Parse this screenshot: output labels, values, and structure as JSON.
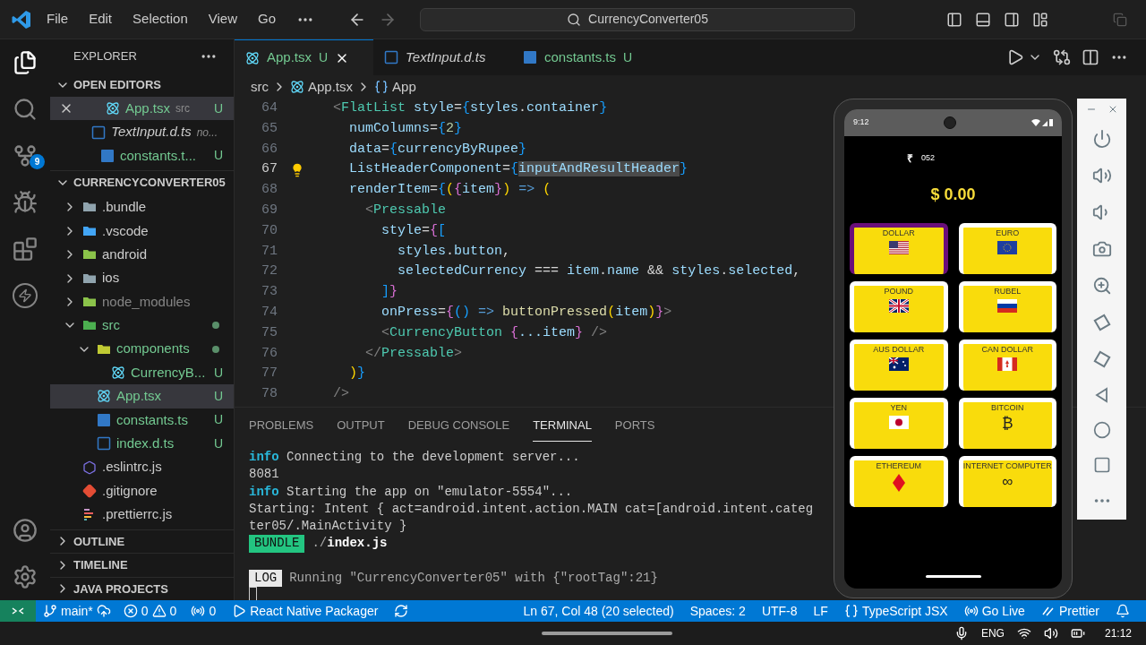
{
  "menu": [
    "File",
    "Edit",
    "Selection",
    "View",
    "Go"
  ],
  "command_center": "CurrencyConverter05",
  "activity": {
    "source_control_badge": "9"
  },
  "explorer": {
    "title": "EXPLORER",
    "open_editors": {
      "title": "OPEN EDITORS",
      "expanded": true,
      "items": [
        {
          "name": "App.tsx",
          "kind": "react",
          "detail": "src",
          "badge": "U",
          "untracked": true,
          "preview": false,
          "selected": true
        },
        {
          "name": "TextInput.d.ts",
          "kind": "tsdecl",
          "detail": "no...",
          "untracked": false,
          "preview": true,
          "selected": false
        },
        {
          "name": "constants.t...",
          "kind": "ts",
          "badge": "U",
          "untracked": true,
          "preview": false,
          "selected": false
        }
      ]
    },
    "project": {
      "title": "CURRENCYCONVERTER05",
      "expanded": true,
      "items": [
        {
          "name": ".bundle",
          "kind": "folder",
          "expanded": false,
          "untracked": false,
          "ignored": false,
          "selected": false
        },
        {
          "name": ".vscode",
          "kind": "vscode",
          "expanded": false,
          "untracked": false,
          "ignored": false,
          "selected": false
        },
        {
          "name": "android",
          "kind": "android",
          "expanded": false,
          "untracked": false,
          "ignored": false,
          "selected": false
        },
        {
          "name": "ios",
          "kind": "ios",
          "expanded": false,
          "untracked": false,
          "ignored": false,
          "selected": false
        },
        {
          "name": "node_modules",
          "kind": "node",
          "expanded": false,
          "untracked": false,
          "ignored": true,
          "selected": false
        },
        {
          "name": "src",
          "kind": "src",
          "expanded": true,
          "untracked": true,
          "ignored": false,
          "dot": true,
          "selected": false,
          "children": [
            {
              "name": "components",
              "kind": "components",
              "expanded": true,
              "untracked": true,
              "ignored": false,
              "dot": true,
              "selected": false,
              "children": [
                {
                  "name": "CurrencyB...",
                  "kind": "react",
                  "badge": "U",
                  "untracked": true,
                  "ignored": false,
                  "selected": false
                }
              ]
            },
            {
              "name": "App.tsx",
              "kind": "react",
              "badge": "U",
              "untracked": true,
              "ignored": false,
              "selected": true
            },
            {
              "name": "constants.ts",
              "kind": "ts",
              "badge": "U",
              "untracked": true,
              "ignored": false,
              "selected": false
            },
            {
              "name": "index.d.ts",
              "kind": "tsdecl",
              "badge": "U",
              "untracked": true,
              "ignored": false,
              "selected": false
            }
          ]
        },
        {
          "name": ".eslintrc.js",
          "kind": "eslint",
          "untracked": false,
          "ignored": false,
          "selected": false
        },
        {
          "name": ".gitignore",
          "kind": "git",
          "untracked": false,
          "ignored": false,
          "selected": false
        },
        {
          "name": ".prettierrc.js",
          "kind": "prettier",
          "untracked": false,
          "ignored": false,
          "selected": false
        }
      ]
    },
    "sections": [
      {
        "title": "OUTLINE",
        "expanded": false
      },
      {
        "title": "TIMELINE",
        "expanded": false
      },
      {
        "title": "JAVA PROJECTS",
        "expanded": false
      }
    ]
  },
  "tabs": [
    {
      "label": "App.tsx",
      "kind": "react",
      "badge": "U",
      "untracked": true,
      "preview": false,
      "selected": true
    },
    {
      "label": "TextInput.d.ts",
      "kind": "tsdecl",
      "untracked": false,
      "preview": true,
      "selected": false
    },
    {
      "label": "constants.ts",
      "kind": "ts",
      "badge": "U",
      "untracked": true,
      "preview": false,
      "selected": false
    }
  ],
  "breadcrumb": [
    "src",
    "App.tsx",
    "App"
  ],
  "lines": [
    {
      "number": "64",
      "current": false,
      "tokens": [
        {
          "kind": "p",
          "text": "  <"
        },
        {
          "kind": "tag",
          "text": "FlatList"
        },
        {
          "kind": "attr",
          "text": " style"
        },
        {
          "kind": "op",
          "text": "="
        },
        {
          "kind": "b3",
          "text": "{"
        },
        {
          "kind": "attr",
          "text": "styles"
        },
        {
          "kind": "op",
          "text": "."
        },
        {
          "kind": "attr",
          "text": "container"
        },
        {
          "kind": "b3",
          "text": "}"
        }
      ]
    },
    {
      "number": "65",
      "current": false,
      "tokens": [
        {
          "kind": "attr",
          "text": "    numColumns"
        },
        {
          "kind": "op",
          "text": "="
        },
        {
          "kind": "b3",
          "text": "{"
        },
        {
          "kind": "num",
          "text": "2"
        },
        {
          "kind": "b3",
          "text": "}"
        }
      ]
    },
    {
      "number": "66",
      "current": false,
      "tokens": [
        {
          "kind": "attr",
          "text": "    data"
        },
        {
          "kind": "op",
          "text": "="
        },
        {
          "kind": "b3",
          "text": "{"
        },
        {
          "kind": "attr",
          "text": "currencyByRupee"
        },
        {
          "kind": "b3",
          "text": "}"
        }
      ]
    },
    {
      "number": "67",
      "current": true,
      "tokens": [
        {
          "kind": "attr",
          "text": "    ListHeaderComponent"
        },
        {
          "kind": "op",
          "text": "="
        },
        {
          "kind": "b3",
          "text": "{"
        },
        {
          "kind": "sel",
          "text": "inputAndResultHeader"
        },
        {
          "kind": "b3",
          "text": "}"
        }
      ]
    },
    {
      "number": "68",
      "current": false,
      "tokens": [
        {
          "kind": "attr",
          "text": "    renderItem"
        },
        {
          "kind": "op",
          "text": "="
        },
        {
          "kind": "b3",
          "text": "{"
        },
        {
          "kind": "b1",
          "text": "("
        },
        {
          "kind": "b2",
          "text": "{"
        },
        {
          "kind": "attr",
          "text": "item"
        },
        {
          "kind": "b2",
          "text": "}"
        },
        {
          "kind": "b1",
          "text": ")"
        },
        {
          "kind": "kw",
          "text": " =>"
        },
        {
          "kind": "b1",
          "text": " ("
        }
      ]
    },
    {
      "number": "69",
      "current": false,
      "tokens": [
        {
          "kind": "p",
          "text": "      <"
        },
        {
          "kind": "tag",
          "text": "Pressable"
        }
      ]
    },
    {
      "number": "70",
      "current": false,
      "tokens": [
        {
          "kind": "attr",
          "text": "        style"
        },
        {
          "kind": "op",
          "text": "="
        },
        {
          "kind": "b2",
          "text": "{"
        },
        {
          "kind": "b3",
          "text": "["
        }
      ]
    },
    {
      "number": "71",
      "current": false,
      "tokens": [
        {
          "kind": "attr",
          "text": "          styles"
        },
        {
          "kind": "op",
          "text": "."
        },
        {
          "kind": "attr",
          "text": "button"
        },
        {
          "kind": "op",
          "text": ","
        }
      ]
    },
    {
      "number": "72",
      "current": false,
      "tokens": [
        {
          "kind": "attr",
          "text": "          selectedCurrency"
        },
        {
          "kind": "op",
          "text": " === "
        },
        {
          "kind": "attr",
          "text": "item"
        },
        {
          "kind": "op",
          "text": "."
        },
        {
          "kind": "attr",
          "text": "name"
        },
        {
          "kind": "op",
          "text": " && "
        },
        {
          "kind": "attr",
          "text": "styles"
        },
        {
          "kind": "op",
          "text": "."
        },
        {
          "kind": "attr",
          "text": "selected"
        },
        {
          "kind": "op",
          "text": ","
        }
      ]
    },
    {
      "number": "73",
      "current": false,
      "tokens": [
        {
          "kind": "b3",
          "text": "        ]"
        },
        {
          "kind": "b2",
          "text": "}"
        }
      ]
    },
    {
      "number": "74",
      "current": false,
      "tokens": [
        {
          "kind": "attr",
          "text": "        onPress"
        },
        {
          "kind": "op",
          "text": "="
        },
        {
          "kind": "b2",
          "text": "{"
        },
        {
          "kind": "b3",
          "text": "()"
        },
        {
          "kind": "kw",
          "text": " =>"
        },
        {
          "kind": "fn",
          "text": " buttonPressed"
        },
        {
          "kind": "b1",
          "text": "("
        },
        {
          "kind": "attr",
          "text": "item"
        },
        {
          "kind": "b1",
          "text": ")"
        },
        {
          "kind": "b2",
          "text": "}"
        },
        {
          "kind": "p",
          "text": ">"
        }
      ]
    },
    {
      "number": "75",
      "current": false,
      "tokens": [
        {
          "kind": "p",
          "text": "        <"
        },
        {
          "kind": "tag",
          "text": "CurrencyButton"
        },
        {
          "kind": "b2",
          "text": " {"
        },
        {
          "kind": "attr",
          "text": "...item"
        },
        {
          "kind": "b2",
          "text": "}"
        },
        {
          "kind": "p",
          "text": " />"
        }
      ]
    },
    {
      "number": "76",
      "current": false,
      "tokens": [
        {
          "kind": "p",
          "text": "      </"
        },
        {
          "kind": "tag",
          "text": "Pressable"
        },
        {
          "kind": "p",
          "text": ">"
        }
      ]
    },
    {
      "number": "77",
      "current": false,
      "tokens": [
        {
          "kind": "b1",
          "text": "    )"
        },
        {
          "kind": "b3",
          "text": "}"
        }
      ]
    },
    {
      "number": "78",
      "current": false,
      "tokens": [
        {
          "kind": "p",
          "text": "  />"
        }
      ]
    }
  ],
  "panel_tabs": [
    {
      "label": "PROBLEMS",
      "selected": false
    },
    {
      "label": "OUTPUT",
      "selected": false
    },
    {
      "label": "DEBUG CONSOLE",
      "selected": false
    },
    {
      "label": "TERMINAL",
      "selected": true
    },
    {
      "label": "PORTS",
      "selected": false
    }
  ],
  "terminal": [
    {
      "kind": "info",
      "tag": "info",
      "text": "Connecting to the development server..."
    },
    {
      "kind": "plain",
      "text": "8081"
    },
    {
      "kind": "info",
      "tag": "info",
      "text": "Starting the app on \"emulator-5554\"..."
    },
    {
      "kind": "plain",
      "text": "Starting: Intent { act=android.intent.action.MAIN cat=[android.intent.categ"
    },
    {
      "kind": "plain",
      "text": "ter05/.MainActivity }"
    },
    {
      "kind": "badge",
      "tag": "BUNDLE",
      "color": "#23c581",
      "text": "./**index.js**"
    },
    {
      "kind": "blank"
    },
    {
      "kind": "badge",
      "tag": "LOG",
      "color": "#e8e8e8",
      "text": "Running \"CurrencyConverter05\" with {\"rootTag\":21}"
    },
    {
      "kind": "cursor"
    }
  ],
  "status_bar": {
    "branch": "main*",
    "errors": "0",
    "warnings": "0",
    "ports": "0",
    "packager": "React Native Packager",
    "right": [
      {
        "kind": "plain",
        "text": "Ln 67, Col 48 (20 selected)"
      },
      {
        "kind": "plain",
        "text": "Spaces: 2"
      },
      {
        "kind": "plain",
        "text": "UTF-8"
      },
      {
        "kind": "plain",
        "text": "LF"
      },
      {
        "kind": "braces",
        "text": "TypeScript JSX"
      },
      {
        "kind": "golive",
        "text": "Go Live"
      },
      {
        "kind": "prettier",
        "text": "Prettier"
      },
      {
        "kind": "bell"
      }
    ]
  },
  "phone": {
    "time": "9:12",
    "currency_sign": "₹",
    "amount_input": "052",
    "result": "$ 0.00",
    "currencies": [
      {
        "name": "DOLLAR",
        "kind": "us",
        "selected": true
      },
      {
        "name": "EURO",
        "kind": "eu",
        "selected": false
      },
      {
        "name": "POUND",
        "kind": "gb",
        "selected": false
      },
      {
        "name": "RUBEL",
        "kind": "ru",
        "selected": false
      },
      {
        "name": "AUS DOLLAR",
        "kind": "au",
        "selected": false
      },
      {
        "name": "CAN DOLLAR",
        "kind": "ca",
        "selected": false
      },
      {
        "name": "YEN",
        "kind": "jp",
        "selected": false
      },
      {
        "name": "BITCOIN",
        "kind": "glyph",
        "symbol": "₿",
        "selected": false
      },
      {
        "name": "ETHEREUM",
        "kind": "diamond",
        "selected": false
      },
      {
        "name": "INTERNET COMPUTER",
        "kind": "glyph",
        "symbol": "∞",
        "selected": false
      }
    ]
  },
  "taskbar": {
    "language": "ENG",
    "clock": "21:12"
  }
}
